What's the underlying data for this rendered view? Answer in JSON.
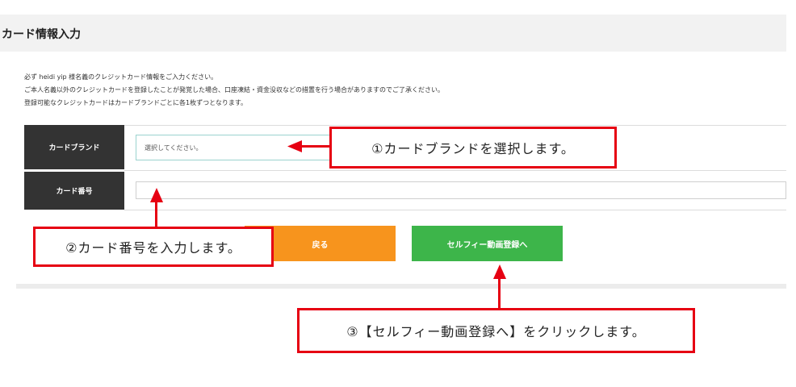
{
  "header": {
    "title": "カード情報入力"
  },
  "notes": [
    "必ず heidi yip 様名義のクレジットカード情報をご入力ください。",
    "ご本人名義以外のクレジットカードを登録したことが発覚した場合、口座凍結・資金没収などの措置を行う場合がありますのでご了承ください。",
    "登録可能なクレジットカードはカードブランドごとに各1枚ずつとなります。"
  ],
  "form": {
    "card_brand_label": "カードブランド",
    "card_brand_value": "選択してください。",
    "card_number_label": "カード番号",
    "card_number_value": ""
  },
  "buttons": {
    "back_label": "戻る",
    "next_label": "セルフィー動画登録へ"
  },
  "callouts": {
    "brand": "①カードブランドを選択します。",
    "number": "②カード番号を入力します。",
    "next": "③【セルフィー動画登録へ】をクリックします。"
  },
  "colors": {
    "back_button": "#f7941d",
    "next_button": "#3db54a",
    "annotation": "#e60012",
    "label_cell": "#333333"
  }
}
